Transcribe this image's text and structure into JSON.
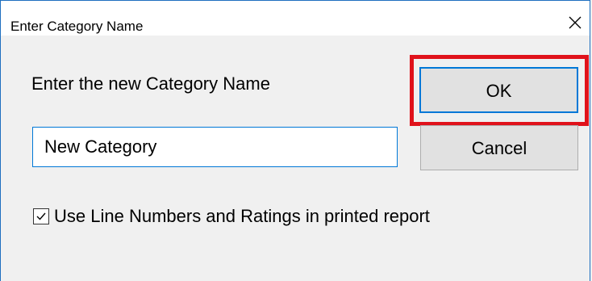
{
  "window": {
    "title": "Enter Category Name"
  },
  "dialog": {
    "prompt": "Enter the new Category Name",
    "category_name_value": "New Category",
    "ok_label": "OK",
    "cancel_label": "Cancel",
    "line_numbers_checkbox_label": "Use Line Numbers and Ratings in printed report",
    "line_numbers_checked": true
  },
  "colors": {
    "highlight": "#e0121b",
    "focus_border": "#0078d7",
    "window_border": "#1e6fbf",
    "background": "#f0f0f0"
  },
  "icons": {
    "close": "close-icon",
    "checkbox": "checkmark-icon"
  }
}
